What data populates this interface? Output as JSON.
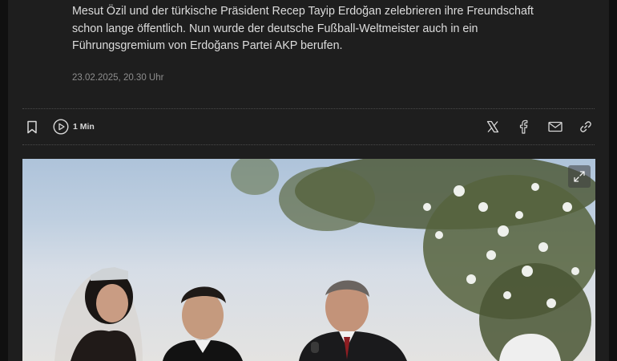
{
  "article": {
    "teaser": "Mesut Özil und der türkische Präsident Recep Tayip Erdoğan zelebrieren ihre Freundschaft schon lange öffentlich. Nun wurde der deutsche Fußball-Weltmeister auch in ein Führungsgremium von Erdoğans Partei AKP berufen.",
    "date": "23.02.2025, 20.30 Uhr"
  },
  "toolbar": {
    "audio_duration": "1 Min"
  },
  "icons": {
    "bookmark": "bookmark-icon",
    "play": "play-circle-icon",
    "x": "x-logo-icon",
    "facebook": "facebook-icon",
    "mail": "mail-icon",
    "link": "link-icon",
    "expand": "expand-icon"
  },
  "colors": {
    "background": "#1e1e1e",
    "text": "#dcdcdc",
    "muted": "#8e8e8e"
  }
}
